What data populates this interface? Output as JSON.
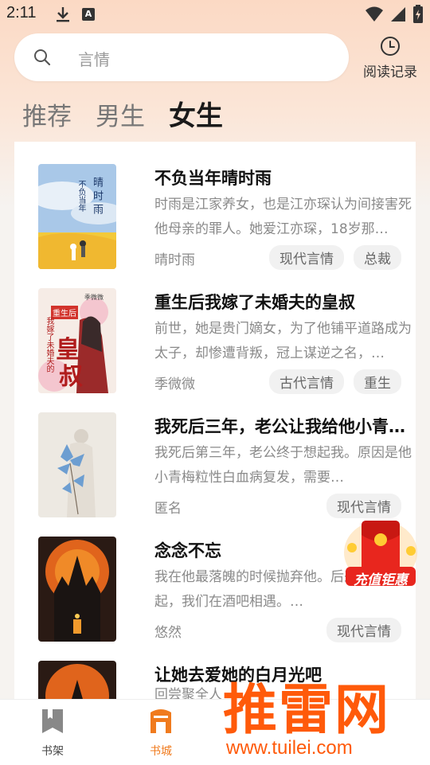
{
  "status_bar": {
    "time": "2:11",
    "a_badge": "A"
  },
  "search": {
    "placeholder": "言情"
  },
  "history": {
    "label": "阅读记录"
  },
  "tabs": [
    {
      "label": "推荐",
      "active": false
    },
    {
      "label": "男生",
      "active": false
    },
    {
      "label": "女生",
      "active": true
    }
  ],
  "books": [
    {
      "title": "不负当年晴时雨",
      "desc": "时雨是江家养女，也是江亦琛认为间接害死他母亲的罪人。她爱江亦琛，18岁那…",
      "author": "晴时雨",
      "tags": [
        "现代言情",
        "总裁"
      ],
      "cover_text": [
        "晴",
        "时",
        "雨",
        "不负当年"
      ]
    },
    {
      "title": "重生后我嫁了未婚夫的皇叔",
      "desc": "前世，她是贵门嫡女，为了他铺平道路成为太子，却惨遭背叛，冠上谋逆之名，…",
      "author": "季微微",
      "tags": [
        "古代言情",
        "重生"
      ],
      "cover_text": [
        "重生后",
        "我嫁了未婚夫的",
        "皇",
        "叔",
        "季微微"
      ]
    },
    {
      "title": "我死后三年，老公让我给他小青…",
      "desc": "我死后第三年，老公终于想起我。原因是他小青梅粒性白血病复发，需要…",
      "author": "匿名",
      "tags": [
        "现代言情"
      ]
    },
    {
      "title": "念念不忘",
      "desc": "我在他最落魄的时候抛弃他。后来他东山再起，我们在酒吧相遇。…",
      "author": "悠然",
      "tags": [
        "现代言情"
      ]
    },
    {
      "title": "让她去爱她的白月光吧",
      "desc": "",
      "author": "回尝聚全人",
      "tags": []
    }
  ],
  "redpacket": {
    "label": "充值钜惠"
  },
  "bottom_nav": [
    {
      "label": "书架",
      "icon": "bookmark-icon",
      "active": false
    },
    {
      "label": "书城",
      "icon": "store-icon",
      "active": true
    }
  ],
  "watermark": {
    "title": "推雷网",
    "url": "www.tuilei.com"
  },
  "colors": {
    "accent": "#f07b1e",
    "title": "#111111",
    "muted": "#8a8a8a"
  }
}
